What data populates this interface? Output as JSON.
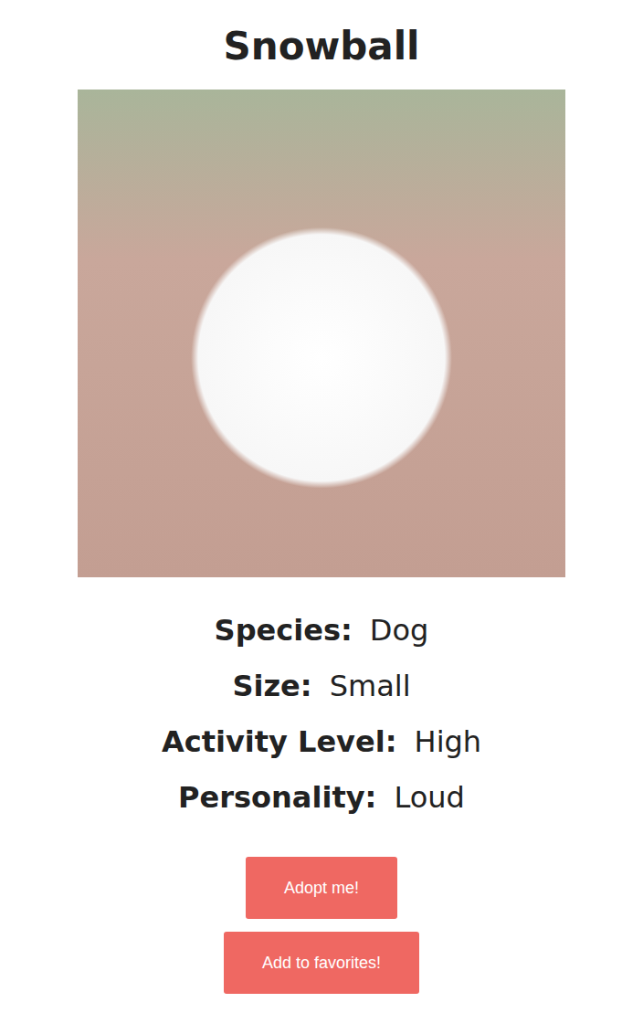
{
  "pet": {
    "name": "Snowball",
    "details": [
      {
        "label": "Species:",
        "value": "Dog"
      },
      {
        "label": "Size:",
        "value": "Small"
      },
      {
        "label": "Activity Level:",
        "value": "High"
      },
      {
        "label": "Personality:",
        "value": "Loud"
      }
    ]
  },
  "buttons": [
    "Adopt me!",
    "Add to favorites!"
  ]
}
